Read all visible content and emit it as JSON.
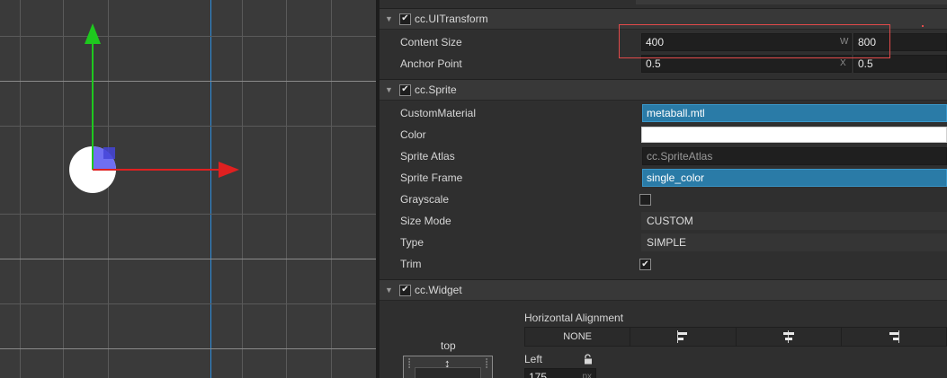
{
  "inspector": {
    "ui_transform": {
      "title": "cc.UITransform",
      "content_size": {
        "label": "Content Size",
        "w_tag": "W",
        "w": "400",
        "h": "800"
      },
      "anchor_point": {
        "label": "Anchor Point",
        "x_tag": "X",
        "x": "0.5",
        "y": "0.5"
      }
    },
    "sprite": {
      "title": "cc.Sprite",
      "custom_material": {
        "label": "CustomMaterial",
        "value": "metaball.mtl"
      },
      "color": {
        "label": "Color",
        "value": "#ffffff"
      },
      "sprite_atlas": {
        "label": "Sprite Atlas",
        "value": "cc.SpriteAtlas"
      },
      "sprite_frame": {
        "label": "Sprite Frame",
        "value": "single_color"
      },
      "grayscale": {
        "label": "Grayscale",
        "checked": false
      },
      "size_mode": {
        "label": "Size Mode",
        "value": "CUSTOM"
      },
      "type": {
        "label": "Type",
        "value": "SIMPLE"
      },
      "trim": {
        "label": "Trim",
        "checked": true
      }
    },
    "widget": {
      "title": "cc.Widget",
      "horizontal_alignment": {
        "title": "Horizontal Alignment",
        "options": [
          "NONE",
          "left-align-icon",
          "center-align-icon",
          "right-align-icon"
        ]
      },
      "top_label": "top",
      "left": {
        "label": "Left",
        "value": "175",
        "unit": "px"
      }
    }
  },
  "colors": {
    "accent_asset": "#2a7ba7",
    "highlight": "#e24a4a",
    "axis_x": "#e02020",
    "axis_y": "#1ec81e"
  }
}
